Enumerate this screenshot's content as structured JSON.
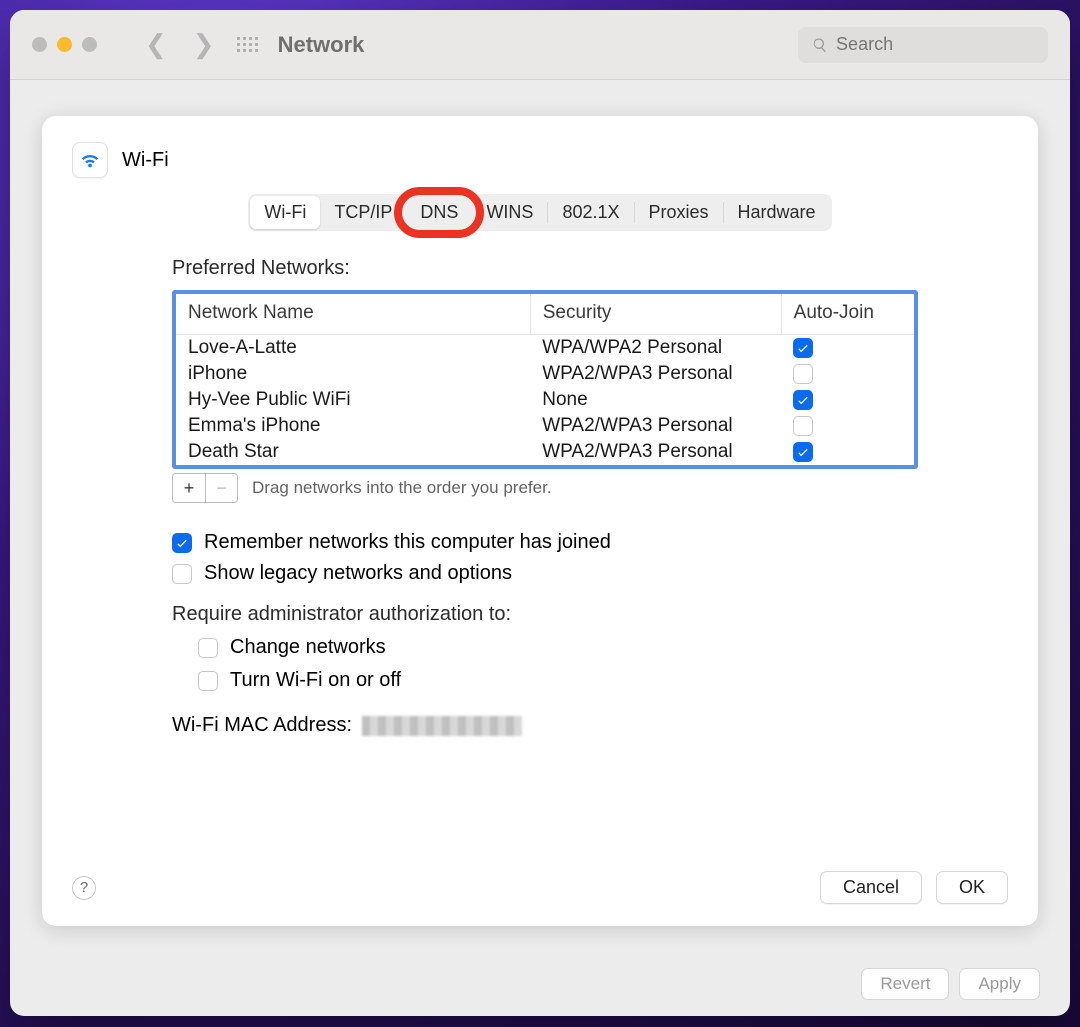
{
  "window": {
    "title": "Network",
    "search_placeholder": "Search"
  },
  "sheet": {
    "title": "Wi-Fi",
    "tabs": [
      "Wi-Fi",
      "TCP/IP",
      "DNS",
      "WINS",
      "802.1X",
      "Proxies",
      "Hardware"
    ],
    "active_tab_index": 0,
    "highlighted_tab_index": 2,
    "preferred_label": "Preferred Networks:",
    "columns": {
      "name": "Network Name",
      "security": "Security",
      "auto": "Auto-Join"
    },
    "rows": [
      {
        "name": "Love-A-Latte",
        "security": "WPA/WPA2 Personal",
        "auto": true
      },
      {
        "name": "iPhone",
        "security": "WPA2/WPA3 Personal",
        "auto": false
      },
      {
        "name": "Hy-Vee Public WiFi",
        "security": "None",
        "auto": true
      },
      {
        "name": "Emma's iPhone",
        "security": "WPA2/WPA3 Personal",
        "auto": false
      },
      {
        "name": "Death Star",
        "security": "WPA2/WPA3 Personal",
        "auto": true
      }
    ],
    "drag_hint": "Drag networks into the order you prefer.",
    "remember_label": "Remember networks this computer has joined",
    "remember_checked": true,
    "legacy_label": "Show legacy networks and options",
    "legacy_checked": false,
    "admin_label": "Require administrator authorization to:",
    "admin_change_label": "Change networks",
    "admin_change_checked": false,
    "admin_toggle_label": "Turn Wi-Fi on or off",
    "admin_toggle_checked": false,
    "mac_label": "Wi-Fi MAC Address:",
    "cancel": "Cancel",
    "ok": "OK"
  },
  "under": {
    "revert": "Revert",
    "apply": "Apply"
  },
  "icons": {
    "add": "+",
    "remove": "−",
    "help": "?"
  },
  "colors": {
    "accent": "#0b6bec",
    "highlight_ring": "#ea3323"
  }
}
